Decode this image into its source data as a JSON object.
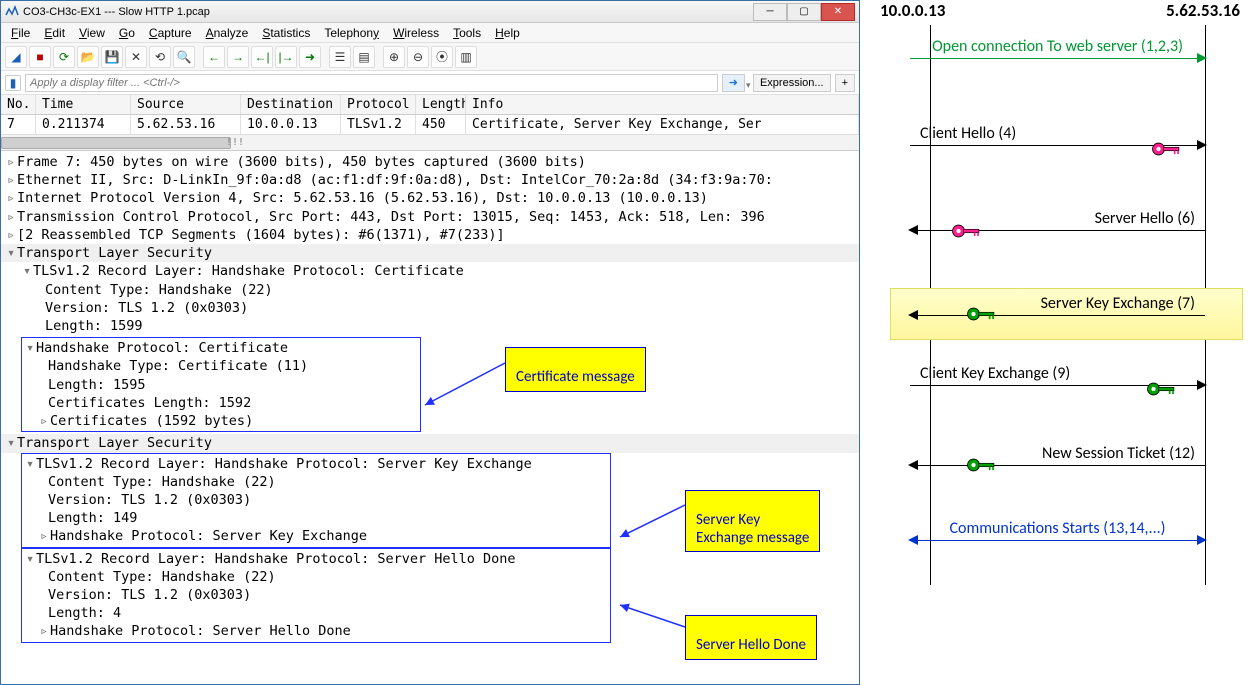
{
  "window": {
    "title": "CO3-CH3c-EX1 --- Slow HTTP 1.pcap"
  },
  "menus": [
    "File",
    "Edit",
    "View",
    "Go",
    "Capture",
    "Analyze",
    "Statistics",
    "Telephony",
    "Wireless",
    "Tools",
    "Help"
  ],
  "filter": {
    "placeholder": "Apply a display filter ... <Ctrl-/>",
    "expression": "Expression...",
    "plus": "+"
  },
  "columns": {
    "no": "No.",
    "time": "Time",
    "src": "Source",
    "dst": "Destination",
    "proto": "Protocol",
    "len": "Length",
    "info": "Info"
  },
  "packet": {
    "no": "7",
    "time": "0.211374",
    "src": "5.62.53.16",
    "dst": "10.0.0.13",
    "proto": "TLSv1.2",
    "len": "450",
    "info": "Certificate, Server Key Exchange, Ser"
  },
  "scroll_tick": "!!!",
  "details": {
    "frame": "Frame 7: 450 bytes on wire (3600 bits), 450 bytes captured (3600 bits)",
    "eth": "Ethernet II, Src: D-LinkIn_9f:0a:d8 (ac:f1:df:9f:0a:d8), Dst: IntelCor_70:2a:8d (34:f3:9a:70:",
    "ip": "Internet Protocol Version 4, Src: 5.62.53.16 (5.62.53.16), Dst: 10.0.0.13 (10.0.0.13)",
    "tcp": "Transmission Control Protocol, Src Port: 443, Dst Port: 13015, Seq: 1453, Ack: 518, Len: 396",
    "reasm": "[2 Reassembled TCP Segments (1604 bytes): #6(1371), #7(233)]",
    "tls1": "Transport Layer Security",
    "rec1": "TLSv1.2 Record Layer: Handshake Protocol: Certificate",
    "ct": "Content Type: Handshake (22)",
    "ver": "Version: TLS 1.2 (0x0303)",
    "len1": "Length: 1599",
    "hs_cert": "Handshake Protocol: Certificate",
    "hs_type": "Handshake Type: Certificate (11)",
    "hs_len": "Length: 1595",
    "certs_len": "Certificates Length: 1592",
    "certs": "Certificates (1592 bytes)",
    "tls2": "Transport Layer Security",
    "rec2": "TLSv1.2 Record Layer: Handshake Protocol: Server Key Exchange",
    "len2": "Length: 149",
    "hs_ske": "Handshake Protocol: Server Key Exchange",
    "rec3": "TLSv1.2 Record Layer: Handshake Protocol: Server Hello Done",
    "len3": "Length: 4",
    "hs_shd": "Handshake Protocol: Server Hello Done"
  },
  "callouts": {
    "cert": "Certificate message",
    "ske": "Server Key\nExchange message",
    "shd": "Server Hello Done"
  },
  "seq": {
    "left_ip": "10.0.0.13",
    "right_ip": "5.62.53.16",
    "open": "Open connection\nTo web server (1,2,3)",
    "chello": "Client Hello (4)",
    "shello": "Server Hello (6)",
    "ske": "Server Key\nExchange (7)",
    "cke": "Client Key\nExchange (9)",
    "nst": "New Session\nTicket (12)",
    "comm": "Communications\nStarts (13,14,...)"
  }
}
